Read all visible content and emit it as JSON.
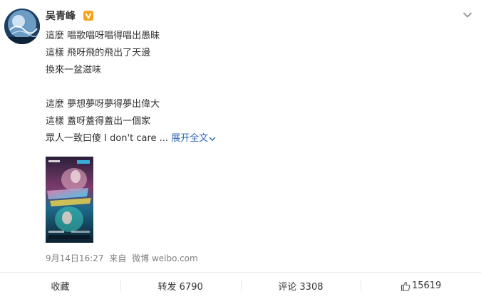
{
  "post": {
    "author": "吴青峰",
    "verified_icon": "verified-badge-icon",
    "lines": [
      "這麼 唱歌唱呀唱得唱出愚昧",
      "這樣 飛呀飛的飛出了天邊",
      "換來一盆滋味",
      "",
      "這麼 夢想夢呀夢得夢出偉大",
      "這樣 蓋呀蓋得蓋出一個家",
      "眾人一致曰傻 I don't care ..."
    ],
    "expand_label": "展开全文",
    "timestamp": "9月14日16:27",
    "source_prefix": "来自",
    "source": "微博 weibo.com"
  },
  "actions": {
    "favorite": "收藏",
    "repost": "转发 6790",
    "comment": "评论 3308",
    "like": "15619"
  },
  "colors": {
    "link": "#2f66b3",
    "verified": "#f7a21b",
    "meta": "#808080"
  }
}
